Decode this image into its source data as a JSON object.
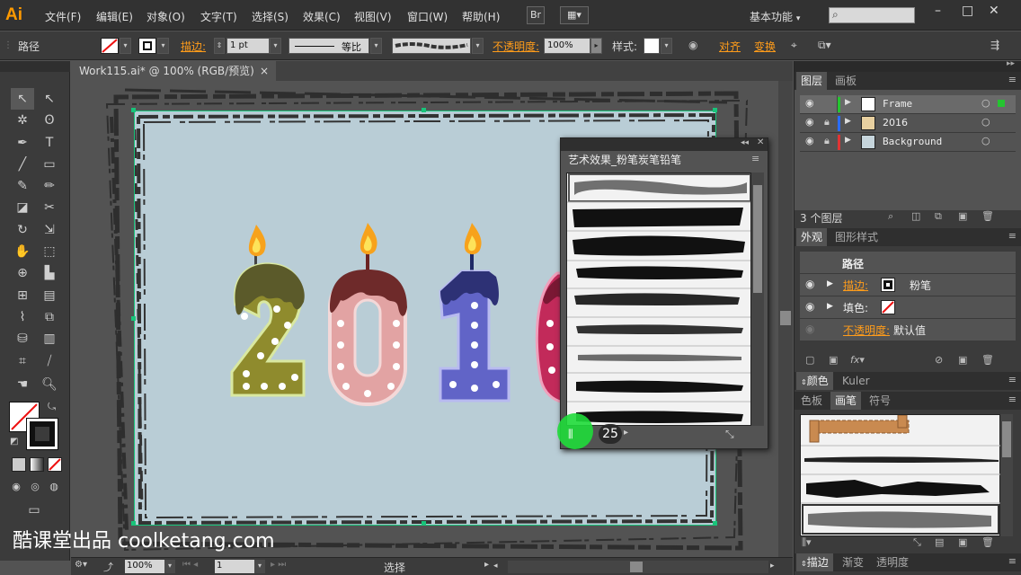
{
  "app": {
    "logo": "Ai"
  },
  "menu": [
    "文件(F)",
    "编辑(E)",
    "对象(O)",
    "文字(T)",
    "选择(S)",
    "效果(C)",
    "视图(V)",
    "窗口(W)",
    "帮助(H)"
  ],
  "menubar": {
    "br_label": "Br",
    "workspace": "基本功能",
    "search_placeholder": ""
  },
  "control": {
    "selection_type": "路径",
    "stroke_label": "描边:",
    "stroke_weight": "1 pt",
    "profile": "等比",
    "opacity_label": "不透明度:",
    "opacity": "100%",
    "style_label": "样式:",
    "align_label": "对齐",
    "transform_label": "变换"
  },
  "document": {
    "tab": "Work115.ai* @ 100% (RGB/预览)",
    "close": "×"
  },
  "artwork": {
    "digits": [
      "2",
      "0",
      "1"
    ]
  },
  "brush_library": {
    "title": "艺术效果_粉笔炭笔铅笔",
    "count": "25"
  },
  "layers_panel": {
    "tabs": [
      "图层",
      "画板"
    ],
    "layers": [
      {
        "name": "Frame",
        "color": "#25c430",
        "thumb": "#ffffff",
        "selected": true
      },
      {
        "name": "2016",
        "color": "#2a6cff",
        "thumb": "#e8d0a0",
        "selected": false
      },
      {
        "name": "Background",
        "color": "#e03434",
        "thumb": "#c6d5dc",
        "selected": false
      }
    ],
    "count": "3 个图层"
  },
  "appearance_panel": {
    "tabs": [
      "外观",
      "图形样式"
    ],
    "header": "路径",
    "stroke_label": "描边:",
    "stroke_value": "粉笔",
    "fill_label": "填色:",
    "opacity_label": "不透明度:",
    "opacity_value": "默认值"
  },
  "color_tabs": [
    "颜色",
    "Kuler"
  ],
  "swatch_tabs": [
    "色板",
    "画笔",
    "符号"
  ],
  "bottom_tabs": [
    "描边",
    "渐变",
    "透明度"
  ],
  "status": {
    "zoom": "100%",
    "page": "1",
    "tool": "选择"
  },
  "watermark": "酷课堂出品 coolketang.com",
  "colors": {
    "accent_orange": "#ff9c1a",
    "selection_green": "#18c47a",
    "highlight_green": "#1fdc3a"
  }
}
